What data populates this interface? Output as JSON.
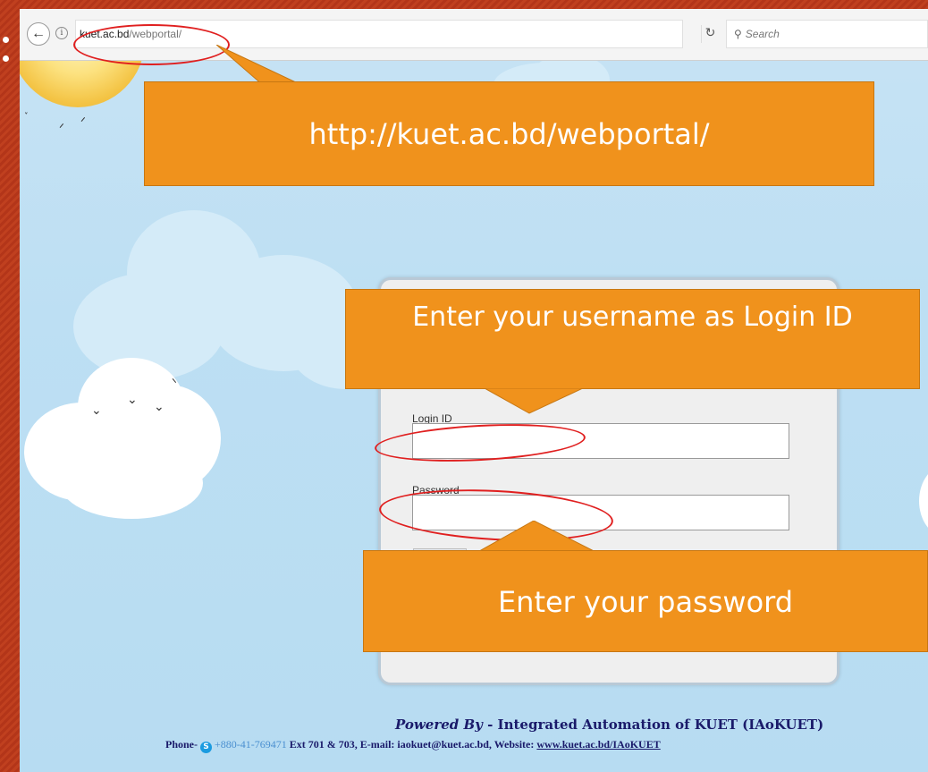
{
  "browser": {
    "url_domain": "kuet.ac.bd",
    "url_path": "/webportal/",
    "search_placeholder": "Search",
    "back_icon": "arrow-left-icon",
    "info_icon": "info-icon",
    "reload_icon": "reload-icon",
    "search_icon": "magnifier-icon"
  },
  "callouts": {
    "url_note": "http://kuet.ac.bd/webportal/",
    "username_note": "Enter your username as Login ID",
    "password_note": "Enter your password"
  },
  "login_form": {
    "login_id_label": "Login ID",
    "password_label": "Password"
  },
  "footer": {
    "powered_by": "Powered By",
    "org": " - Integrated  Automation  of  KUET  (IAoKUET)",
    "phone_label": "Phone-",
    "phone_number": "+880-41-769471",
    "contact_details": " Ext 701 & 703, E-mail: iaokuet@kuet.ac.bd, Website: ",
    "website": "www.kuet.ac.bd/IAoKUET"
  },
  "colors": {
    "slide_border": "#b8381d",
    "callout_fill": "#f0921c",
    "annotation_red": "#e01f1f",
    "sky": "#bddff3"
  }
}
